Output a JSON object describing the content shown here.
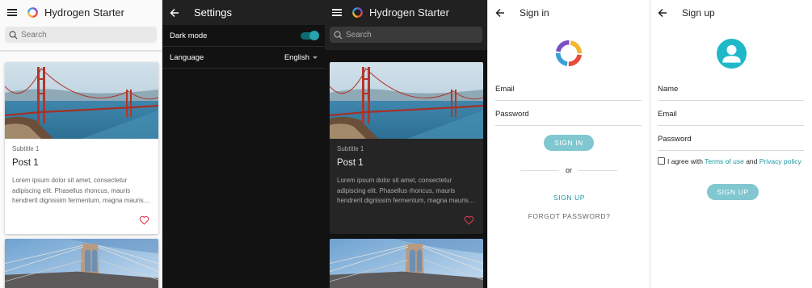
{
  "home": {
    "title": "Hydrogen Starter",
    "search_placeholder": "Search",
    "cards": [
      {
        "subtitle": "Subtitle 1",
        "title": "Post 1",
        "text": "Lorem ipsum dolor sit amet, consectetur adipiscing elit. Phasellus rhoncus, mauris hendrerit dignissim fermentum, magna mauris…"
      }
    ]
  },
  "settings": {
    "title": "Settings",
    "dark_mode_label": "Dark mode",
    "dark_mode_on": true,
    "language_label": "Language",
    "language_value": "English"
  },
  "signin": {
    "title": "Sign in",
    "email_label": "Email",
    "password_label": "Password",
    "signin_button": "SIGN IN",
    "or_text": "or",
    "signup_link": "SIGN UP",
    "forgot_link": "FORGOT PASSWORD?"
  },
  "signup": {
    "title": "Sign up",
    "name_label": "Name",
    "email_label": "Email",
    "password_label": "Password",
    "agree_prefix": "I agree with",
    "terms_link": "Terms of use",
    "and_text": "and",
    "privacy_link": "Privacy policy",
    "signup_button": "SIGN UP"
  },
  "colors": {
    "accent_teal": "#1d97a3",
    "button_teal": "#80c7d0",
    "heart_red": "#e0394b",
    "dark_bg": "#121212",
    "dark_bar": "#212121"
  },
  "icons": [
    "menu-icon",
    "hydrogen-logo-icon",
    "search-icon",
    "heart-icon",
    "back-arrow-icon",
    "toggle-switch",
    "dropdown-caret-icon",
    "account-avatar-icon",
    "checkbox"
  ]
}
